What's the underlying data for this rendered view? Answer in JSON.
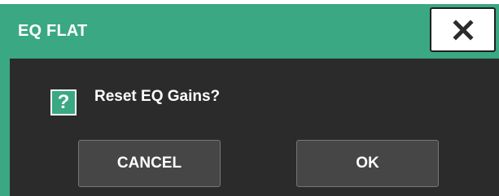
{
  "dialog": {
    "title": "EQ FLAT",
    "close_icon": "close-icon",
    "message_icon": "question-icon",
    "question_glyph": "?",
    "message": "Reset EQ Gains?",
    "buttons": {
      "cancel_label": "CANCEL",
      "ok_label": "OK"
    }
  },
  "colors": {
    "header": "#3aa882",
    "panel": "#2b2b2b",
    "button": "#464646",
    "text": "#ffffff"
  }
}
